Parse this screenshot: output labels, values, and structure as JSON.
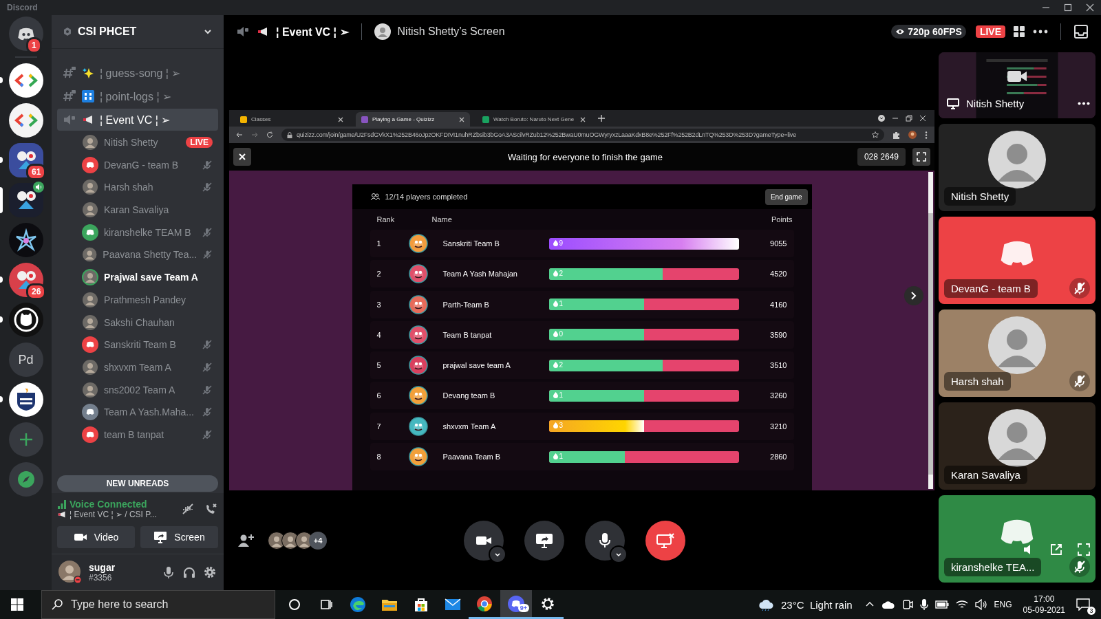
{
  "window": {
    "title": "Discord"
  },
  "servers": [
    {
      "kind": "home",
      "color": "#36393f",
      "badge": "1",
      "unread": false,
      "selected": false
    },
    {
      "kind": "code",
      "color": "#ffffff",
      "unread": true,
      "selected": false
    },
    {
      "kind": "code",
      "color": "#f4f4f4",
      "unread": false,
      "selected": false
    },
    {
      "kind": "emblem",
      "color": "#3b4d9e",
      "badge": "61",
      "unread": true,
      "selected": false
    },
    {
      "kind": "emblem",
      "color": "#1b1f2e",
      "speaking": true,
      "unread": false,
      "selected": true
    },
    {
      "kind": "star",
      "color": "#0c0c10",
      "unread": false,
      "selected": false
    },
    {
      "kind": "emblem",
      "color": "#d8404a",
      "badge": "26",
      "unread": true,
      "selected": false
    },
    {
      "kind": "cat",
      "color": "#111111",
      "unread": true,
      "selected": false
    },
    {
      "kind": "text",
      "color": "#36393f",
      "label": "Pd",
      "unread": false,
      "selected": false
    },
    {
      "kind": "shield",
      "color": "#ffffff",
      "unread": true,
      "selected": false
    },
    {
      "kind": "add",
      "color": "#36393f",
      "unread": false,
      "selected": false
    },
    {
      "kind": "explore",
      "color": "#36393f",
      "unread": false,
      "selected": false
    }
  ],
  "guild": {
    "name": "CSI PHCET"
  },
  "channels": [
    {
      "kind": "sparkle-text",
      "name": "¦ guess-song ¦ ➢",
      "selected": false
    },
    {
      "kind": "numbers-text",
      "name": "¦ point-logs ¦ ➢",
      "selected": false
    },
    {
      "kind": "megaphone-voice",
      "name": "¦ Event VC ¦ ➢",
      "selected": true
    }
  ],
  "members": [
    {
      "name": "Nitish Shetty",
      "badge": "LIVE",
      "muted": false,
      "speaking": false
    },
    {
      "name": "DevanG - team B",
      "kind": "discord",
      "color": "#ed4245",
      "muted": true,
      "speaking": false
    },
    {
      "name": "Harsh shah",
      "muted": true,
      "speaking": false
    },
    {
      "name": "Karan Savaliya",
      "muted": false,
      "speaking": false
    },
    {
      "name": "kiranshelke TEAM B",
      "kind": "discord",
      "color": "#3ba55d",
      "muted": true,
      "speaking": false
    },
    {
      "name": "Paavana Shetty Tea...",
      "muted": true,
      "speaking": false
    },
    {
      "name": "Prajwal save Team A",
      "muted": false,
      "speaking": true
    },
    {
      "name": "Prathmesh Pandey",
      "muted": false,
      "speaking": false
    },
    {
      "name": "Sakshi Chauhan",
      "muted": false,
      "speaking": false
    },
    {
      "name": "Sanskriti Team B",
      "kind": "discord",
      "color": "#ed4245",
      "muted": true,
      "speaking": false
    },
    {
      "name": "shxvxm Team A",
      "muted": true,
      "speaking": false
    },
    {
      "name": "sns2002 Team A",
      "muted": true,
      "speaking": false
    },
    {
      "name": "Team A Yash.Maha...",
      "kind": "discord",
      "color": "#747f8d",
      "muted": true,
      "speaking": false
    },
    {
      "name": "team B tanpat",
      "kind": "discord",
      "color": "#ed4245",
      "muted": true,
      "speaking": false
    }
  ],
  "new_unreads": "NEW UNREADS",
  "voice": {
    "status": "Voice Connected",
    "channel": "¦ Event VC ¦ ➢ / CSI P...",
    "video": "Video",
    "screen": "Screen"
  },
  "user": {
    "name": "sugar",
    "tag": "#3356"
  },
  "header": {
    "channel": "¦ Event VC ¦ ➢",
    "stream": "Nitish Shetty’s Screen",
    "quality": "720p 60FPS",
    "live": "LIVE"
  },
  "browser": {
    "tabs": [
      {
        "title": "Classes",
        "selected": false
      },
      {
        "title": "Playing a Game - Quizizz",
        "selected": true
      },
      {
        "title": "Watch Boruto: Naruto Next Gene",
        "selected": false
      }
    ],
    "url": "quizizz.com/join/game/U2FsdGVkX1%252B46oJpzOKFDIVI1nuhRZbsib3bGoA3AScilvRZub12%252BwaU0muOGWyryxzLaaaKdxB8e%252Ff%252B2dLnTQ%253D%253D?gameType=live"
  },
  "quiz": {
    "status": "Waiting for everyone to finish the game",
    "code": "028 2649",
    "completed": "12/14 players completed",
    "end": "End game",
    "columns": [
      "Rank",
      "Name",
      "Points"
    ],
    "rows": [
      {
        "rank": "1",
        "name": "Sanskriti Team B",
        "streak": "9",
        "kind": "perfect",
        "level": 1.0,
        "points": "9055",
        "color": "#f39c3d"
      },
      {
        "rank": "2",
        "name": "Team A Yash Mahajan",
        "streak": "2",
        "kind": "mixed",
        "level": 0.6,
        "points": "4520",
        "color": "#e0506a"
      },
      {
        "rank": "3",
        "name": "Parth-Team B",
        "streak": "1",
        "kind": "mixed",
        "level": 0.5,
        "points": "4160",
        "color": "#e66b5a"
      },
      {
        "rank": "4",
        "name": "Team B tanpat",
        "streak": "0",
        "kind": "mixed",
        "level": 0.5,
        "points": "3590",
        "color": "#e0506a"
      },
      {
        "rank": "5",
        "name": "prajwal save team A",
        "streak": "2",
        "kind": "mixed",
        "level": 0.6,
        "points": "3510",
        "color": "#d9405e"
      },
      {
        "rank": "6",
        "name": "Devang team B",
        "streak": "1",
        "kind": "mixed",
        "level": 0.5,
        "points": "3260",
        "color": "#f2a03a"
      },
      {
        "rank": "7",
        "name": "shxvxm Team A",
        "streak": "3",
        "kind": "streak",
        "level": 0.5,
        "points": "3210",
        "color": "#46b8c0"
      },
      {
        "rank": "8",
        "name": "Paavana Team B",
        "streak": "1",
        "kind": "mixed",
        "level": 0.4,
        "points": "2860",
        "color": "#f2a03a"
      }
    ]
  },
  "call": {
    "extra": "+4"
  },
  "tiles": [
    {
      "kind": "screen",
      "name": "Nitish Shetty",
      "color": "#2a1828",
      "muted": false
    },
    {
      "kind": "avatar",
      "name": "Nitish Shetty",
      "color": "#232323",
      "muted": false
    },
    {
      "kind": "discord",
      "name": "DevanG - team B",
      "color": "#ed4245",
      "muted": true
    },
    {
      "kind": "avatar",
      "name": "Harsh shah",
      "color": "#9c8166",
      "muted": true
    },
    {
      "kind": "avatar",
      "name": "Karan Savaliya",
      "color": "#2b221a",
      "muted": false
    },
    {
      "kind": "discord",
      "name": "kiranshelke TEA...",
      "color": "#2f8a45",
      "muted": true
    }
  ],
  "taskbar": {
    "search": {
      "placeholder": "Type here to search"
    },
    "apps": [
      {
        "kind": "cortana",
        "running": false,
        "selected": false
      },
      {
        "kind": "taskview",
        "running": false,
        "selected": false
      },
      {
        "kind": "edge",
        "running": false,
        "selected": false
      },
      {
        "kind": "folder",
        "running": false,
        "selected": false
      },
      {
        "kind": "store",
        "running": false,
        "selected": false
      },
      {
        "kind": "mail",
        "running": false,
        "selected": false
      },
      {
        "kind": "chrome",
        "running": true,
        "selected": false
      },
      {
        "kind": "discord",
        "running": true,
        "selected": true,
        "badge": "9+"
      },
      {
        "kind": "settings",
        "running": true,
        "selected": false
      }
    ],
    "weather": "23°C  Light rain",
    "language": "ENG",
    "time": "17:00",
    "date": "05-09-2021",
    "notifications": "3"
  }
}
